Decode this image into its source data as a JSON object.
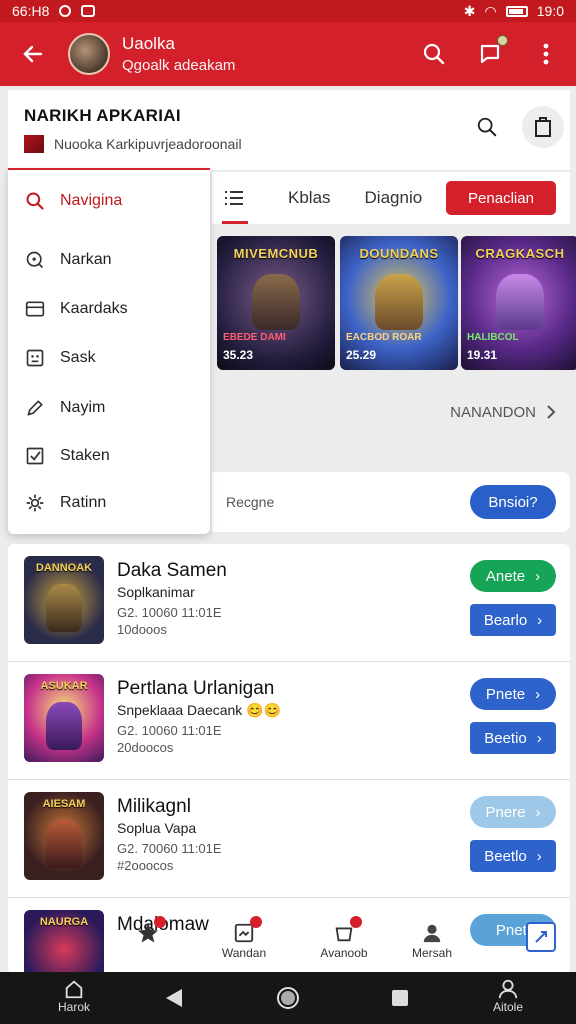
{
  "colors": {
    "brand_red": "#d3202a",
    "blue": "#2f63cc",
    "green": "#16a456",
    "light_blue": "#9dc8e8"
  },
  "status_bar": {
    "left_text": "66:H8",
    "time": "19:0"
  },
  "app_bar": {
    "title": "Uaolka",
    "subtitle": "Qgoalk adeakam",
    "icons": [
      "back-arrow-icon",
      "search-icon",
      "chat-icon",
      "more-vert-icon"
    ]
  },
  "header": {
    "name": "NARIKH APKARIAI",
    "subtitle": "Nuooka Karkipuvrjeadoroonail"
  },
  "menu": {
    "items": [
      {
        "label": "Navigina",
        "icon": "search-icon",
        "active": true
      },
      {
        "label": "Narkan",
        "icon": "compass-icon",
        "active": false
      },
      {
        "label": "Kaardaks",
        "icon": "card-icon",
        "active": false
      },
      {
        "label": "Sask",
        "icon": "grid-icon",
        "active": false
      },
      {
        "label": "Nayim",
        "icon": "pen-icon",
        "active": false
      },
      {
        "label": "Staken",
        "icon": "checkbox-icon",
        "active": false
      },
      {
        "label": "Ratinn",
        "icon": "gear-icon",
        "active": false
      }
    ]
  },
  "tabs": {
    "items": [
      "Kblas",
      "Diagnio"
    ],
    "cta": "Penaclian"
  },
  "games": [
    {
      "title": "MIVEMCNUB",
      "sub": "EBEDE DAMI",
      "price": "35.23"
    },
    {
      "title": "DOUNDANS",
      "sub": "EACBOD ROAR",
      "price": "25.29"
    },
    {
      "title": "CRAGKASCH",
      "sub": "HALIBCOL",
      "price": "19.31"
    }
  ],
  "more": {
    "label": "NANANDON"
  },
  "search": {
    "label": "Recgne",
    "button": "Bnsioi?"
  },
  "list": [
    {
      "thumb": "DANNOAK",
      "title": "Daka Samen",
      "sub": "Soplkanimar",
      "meta1": "G2. 10060 11:01E",
      "meta2": "10dooos",
      "btn1": "Anete",
      "btn1_color": "#16a456",
      "btn2": "Bearlo"
    },
    {
      "thumb": "ASUKAR",
      "title": "Pertlana Urlanigan",
      "sub": "Snpeklaaa Daecank 😊😊",
      "meta1": "G2. 10060 11:01E",
      "meta2": "20doocos",
      "btn1": "Pnete",
      "btn1_color": "#2f63cc",
      "btn2": "Beetio"
    },
    {
      "thumb": "AIESAM",
      "title": "Milikagnl",
      "sub": "Soplua Vapa",
      "meta1": "G2. 70060 11:01E",
      "meta2": "#2ooocos",
      "btn1": "Pnere",
      "btn1_color": "#9dc8e8",
      "btn2": "Beetlo"
    },
    {
      "thumb": "NAURGA",
      "title": "Mdalomaw",
      "sub": "",
      "meta1": "",
      "meta2": "",
      "btn1": "Pnetl",
      "btn1_color": "#5aa3d8",
      "btn2": ""
    }
  ],
  "float_tabs": [
    {
      "label": "",
      "icon": "star-icon"
    },
    {
      "label": "Wandan",
      "icon": "news-icon"
    },
    {
      "label": "Avanoob",
      "icon": "shopping-icon"
    },
    {
      "label": "Mersah",
      "icon": "person-icon"
    }
  ],
  "system_nav": {
    "home_label": "Harok",
    "account_label": "Aitole"
  }
}
